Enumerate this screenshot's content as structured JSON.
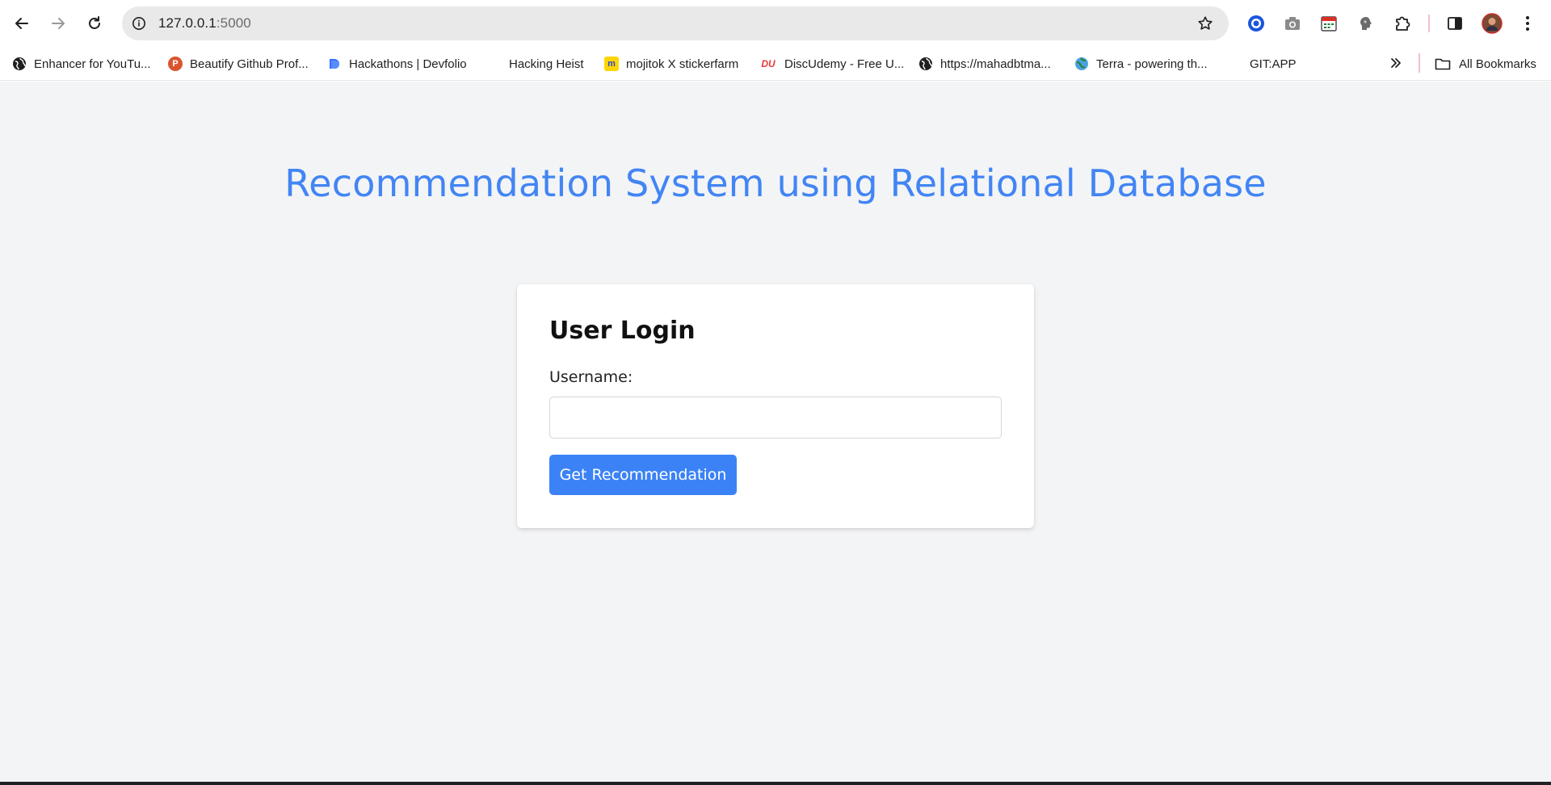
{
  "browser": {
    "url_host": "127.0.0.1",
    "url_port": ":5000",
    "bookmarks": [
      {
        "label": "Enhancer for YouTu...",
        "icon": "globe-icon"
      },
      {
        "label": "Beautify Github Prof...",
        "icon": "p-badge-icon"
      },
      {
        "label": "Hackathons | Devfolio",
        "icon": "devfolio-icon"
      },
      {
        "label": "Hacking Heist",
        "icon": "none"
      },
      {
        "label": "mojitok X stickerfarm",
        "icon": "mojitok-icon"
      },
      {
        "label": "DiscUdemy - Free U...",
        "icon": "discudemy-icon"
      },
      {
        "label": "https://mahadbtma...",
        "icon": "globe-icon"
      },
      {
        "label": "Terra - powering th...",
        "icon": "terra-icon"
      },
      {
        "label": "GIT:APP",
        "icon": "none"
      }
    ],
    "all_bookmarks_label": "All Bookmarks",
    "colors": {
      "omnibox": "#e9e9ea",
      "page_bg": "#f3f4f6"
    }
  },
  "page": {
    "title": "Recommendation System using Relational Database",
    "login": {
      "heading": "User Login",
      "username_label": "Username:",
      "username_value": "",
      "button_label": "Get Recommendation"
    },
    "colors": {
      "title": "#4285f4",
      "button": "#3b82f6"
    }
  }
}
